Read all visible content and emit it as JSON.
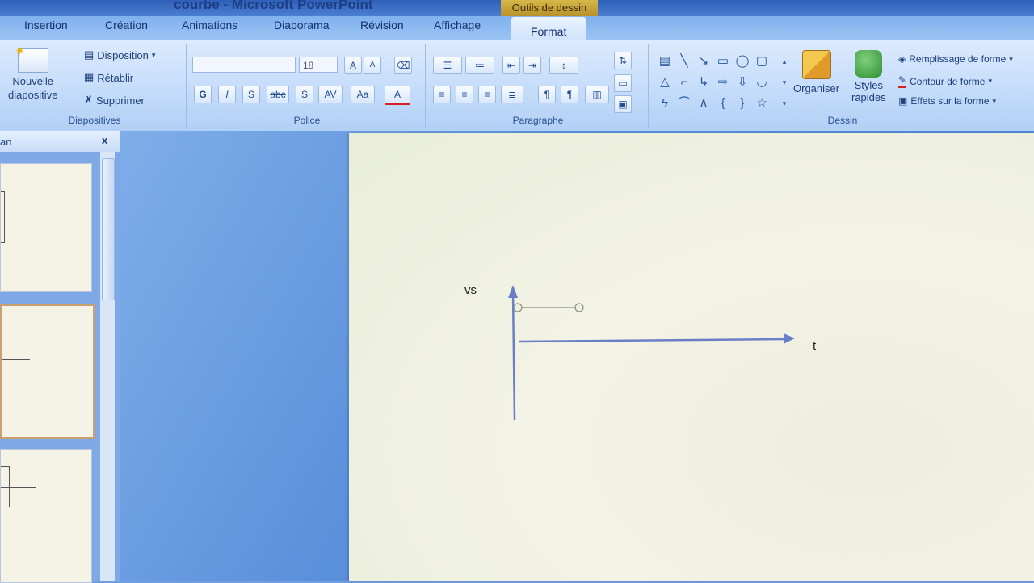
{
  "window": {
    "title": "courbe - Microsoft PowerPoint",
    "context_tab": "Outils de dessin"
  },
  "tabs": [
    {
      "label": "Insertion"
    },
    {
      "label": "Création"
    },
    {
      "label": "Animations"
    },
    {
      "label": "Diaporama"
    },
    {
      "label": "Révision"
    },
    {
      "label": "Affichage"
    },
    {
      "label": "Format"
    }
  ],
  "ribbon": {
    "diapositives": {
      "label": "Diapositives",
      "new_slide": "Nouvelle\ndiapositive",
      "layout": "Disposition",
      "reset": "Rétablir",
      "delete": "Supprimer"
    },
    "police": {
      "label": "Police",
      "font_name": "",
      "font_size": "18",
      "bold": "G",
      "italic": "I",
      "underline": "S",
      "strike": "abc",
      "shadow": "S",
      "spacing": "AV",
      "case": "Aa",
      "grow": "A",
      "shrink": "A"
    },
    "paragraphe": {
      "label": "Paragraphe"
    },
    "dessin": {
      "label": "Dessin",
      "arrange": "Organiser",
      "quick_styles": "Styles\nrapides",
      "fill": "Remplissage de forme",
      "outline": "Contour de forme",
      "effects": "Effets sur la forme"
    }
  },
  "panel": {
    "tab_label": "an",
    "close": "x"
  },
  "slide": {
    "y_label": "vs",
    "x_label": "t"
  },
  "icons": [
    "new-slide-icon",
    "layout-icon",
    "reset-icon",
    "delete-icon",
    "font-grow-icon",
    "font-shrink-icon",
    "clear-format-icon",
    "bullets-icon",
    "numbering-icon",
    "align-left-icon",
    "align-center-icon",
    "align-right-icon",
    "justify-icon",
    "shapes-gallery-icon",
    "arrange-icon",
    "quick-styles-icon",
    "fill-icon",
    "outline-icon",
    "effects-icon"
  ]
}
